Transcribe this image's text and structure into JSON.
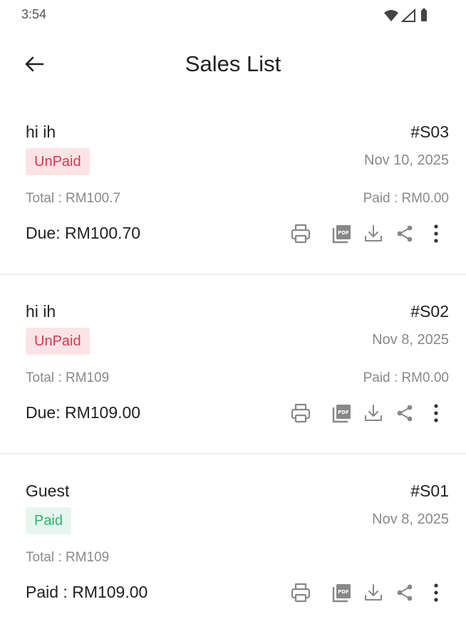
{
  "status_bar": {
    "time": "3:54",
    "icons": [
      "wifi-icon",
      "signal-icon",
      "battery-icon"
    ]
  },
  "app_bar": {
    "back_icon": "arrow-left-icon",
    "title": "Sales List"
  },
  "colors": {
    "unpaid_text": "#e0344b",
    "unpaid_bg": "#fce4e6",
    "paid_text": "#2bb673",
    "paid_bg": "#e6f6ee",
    "icon_gray": "#888888"
  },
  "sales": [
    {
      "customer": "hi ih",
      "invoice": "#S03",
      "status": "UnPaid",
      "date": "Nov 10, 2025",
      "total": "Total : RM100.7",
      "paid": "Paid : RM0.00",
      "due": "Due: RM100.70",
      "actions": [
        "print-icon",
        "pdf-icon",
        "download-icon",
        "share-icon",
        "more-vert-icon"
      ]
    },
    {
      "customer": "hi ih",
      "invoice": "#S02",
      "status": "UnPaid",
      "date": "Nov 8, 2025",
      "total": "Total : RM109",
      "paid": "Paid : RM0.00",
      "due": "Due: RM109.00",
      "actions": [
        "print-icon",
        "pdf-icon",
        "download-icon",
        "share-icon",
        "more-vert-icon"
      ]
    },
    {
      "customer": "Guest",
      "invoice": "#S01",
      "status": "Paid",
      "date": "Nov 8, 2025",
      "total": "Total : RM109",
      "paid": "",
      "due": "Paid : RM109.00",
      "actions": [
        "print-icon",
        "pdf-icon",
        "download-icon",
        "share-icon",
        "more-vert-icon"
      ]
    }
  ]
}
